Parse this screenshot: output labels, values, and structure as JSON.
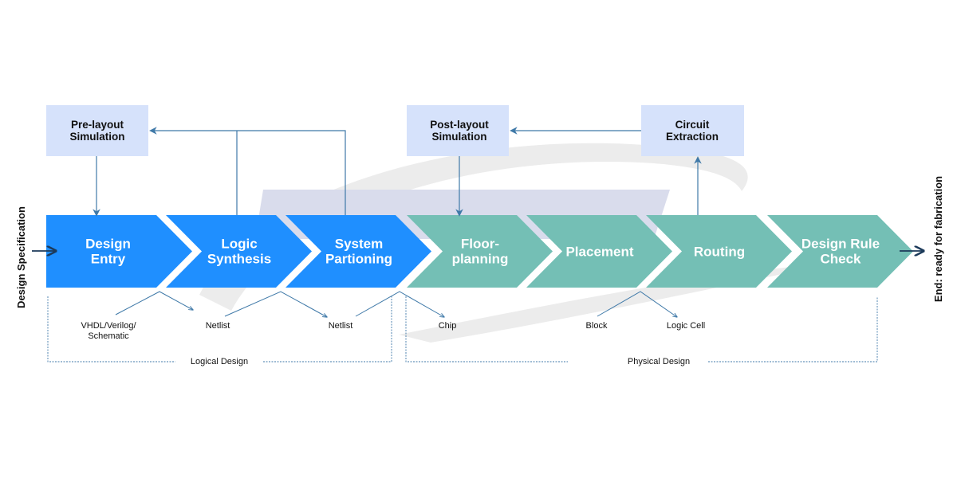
{
  "colors": {
    "logical_stage": "#1f8fff",
    "physical_stage": "#74bfb5",
    "sim_box": "#d6e2fb",
    "connector": "#3f79a8",
    "io_arrow": "#1c3a5a",
    "watermark_gray": "#ececec",
    "watermark_lavender": "#d9dcec"
  },
  "input_label": "Design Specification",
  "output_label": "End: ready for fabrication",
  "stages": [
    {
      "lines": [
        "Design",
        "Entry"
      ],
      "group": "logical"
    },
    {
      "lines": [
        "Logic",
        "Synthesis"
      ],
      "group": "logical"
    },
    {
      "lines": [
        "System",
        "Partioning"
      ],
      "group": "logical"
    },
    {
      "lines": [
        "Floor-",
        "planning"
      ],
      "group": "physical"
    },
    {
      "lines": [
        "Placement"
      ],
      "group": "physical"
    },
    {
      "lines": [
        "Routing"
      ],
      "group": "physical"
    },
    {
      "lines": [
        "Design Rule",
        "Check"
      ],
      "group": "physical"
    }
  ],
  "feedback_boxes": {
    "pre_layout": [
      "Pre-layout",
      "Simulation"
    ],
    "post_layout": [
      "Post-layout",
      "Simulation"
    ],
    "circuit_extraction": [
      "Circuit",
      "Extraction"
    ]
  },
  "outputs": {
    "vhdl": [
      "VHDL/Verilog/",
      "Schematic"
    ],
    "netlist_1": "Netlist",
    "netlist_2": "Netlist",
    "chip": "Chip",
    "block": "Block",
    "logic_cell": "Logic Cell"
  },
  "groups": {
    "logical": "Logical Design",
    "physical": "Physical Design"
  }
}
